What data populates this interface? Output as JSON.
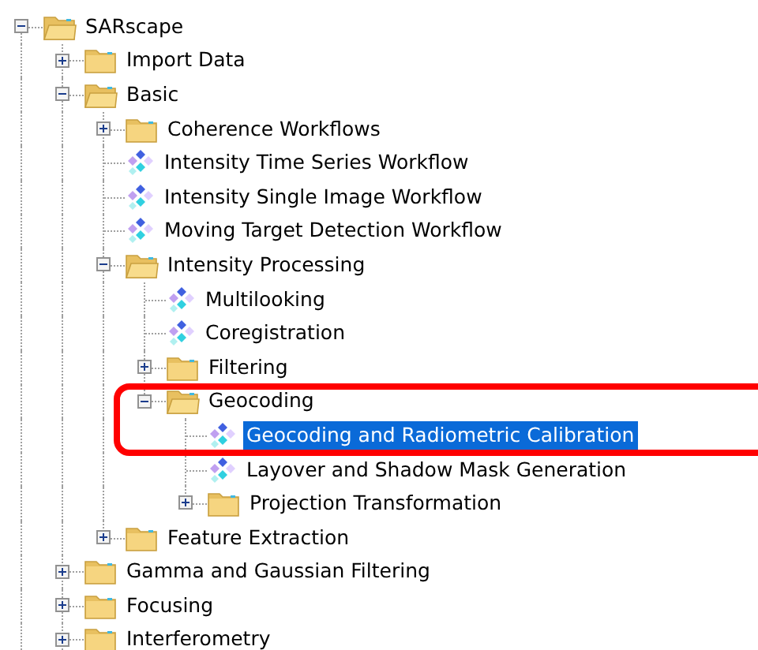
{
  "tree": [
    {
      "label": "SARscape",
      "kind": "folder",
      "expanded": true,
      "selected": false,
      "children": [
        {
          "label": "Import Data",
          "kind": "folder",
          "expanded": false,
          "selected": false
        },
        {
          "label": "Basic",
          "kind": "folder",
          "expanded": true,
          "selected": false,
          "children": [
            {
              "label": "Coherence Workflows",
              "kind": "folder",
              "expanded": false,
              "selected": false
            },
            {
              "label": "Intensity Time Series Workflow",
              "kind": "tool",
              "selected": false
            },
            {
              "label": "Intensity Single Image Workflow",
              "kind": "tool",
              "selected": false
            },
            {
              "label": "Moving Target Detection Workflow",
              "kind": "tool",
              "selected": false
            },
            {
              "label": "Intensity Processing",
              "kind": "folder",
              "expanded": true,
              "selected": false,
              "children": [
                {
                  "label": "Multilooking",
                  "kind": "tool",
                  "selected": false
                },
                {
                  "label": "Coregistration",
                  "kind": "tool",
                  "selected": false
                },
                {
                  "label": "Filtering",
                  "kind": "folder",
                  "expanded": false,
                  "selected": false
                },
                {
                  "label": "Geocoding",
                  "kind": "folder",
                  "expanded": true,
                  "selected": false,
                  "children": [
                    {
                      "label": "Geocoding and Radiometric Calibration",
                      "kind": "tool",
                      "selected": true
                    },
                    {
                      "label": "Layover and Shadow Mask Generation",
                      "kind": "tool",
                      "selected": false
                    },
                    {
                      "label": "Projection Transformation",
                      "kind": "folder",
                      "expanded": false,
                      "selected": false
                    }
                  ]
                }
              ]
            },
            {
              "label": "Feature Extraction",
              "kind": "folder",
              "expanded": false,
              "selected": false
            }
          ]
        },
        {
          "label": "Gamma and Gaussian Filtering",
          "kind": "folder",
          "expanded": false,
          "selected": false
        },
        {
          "label": "Focusing",
          "kind": "folder",
          "expanded": false,
          "selected": false
        },
        {
          "label": "Interferometry",
          "kind": "folder",
          "expanded": false,
          "selected": false
        }
      ]
    }
  ]
}
